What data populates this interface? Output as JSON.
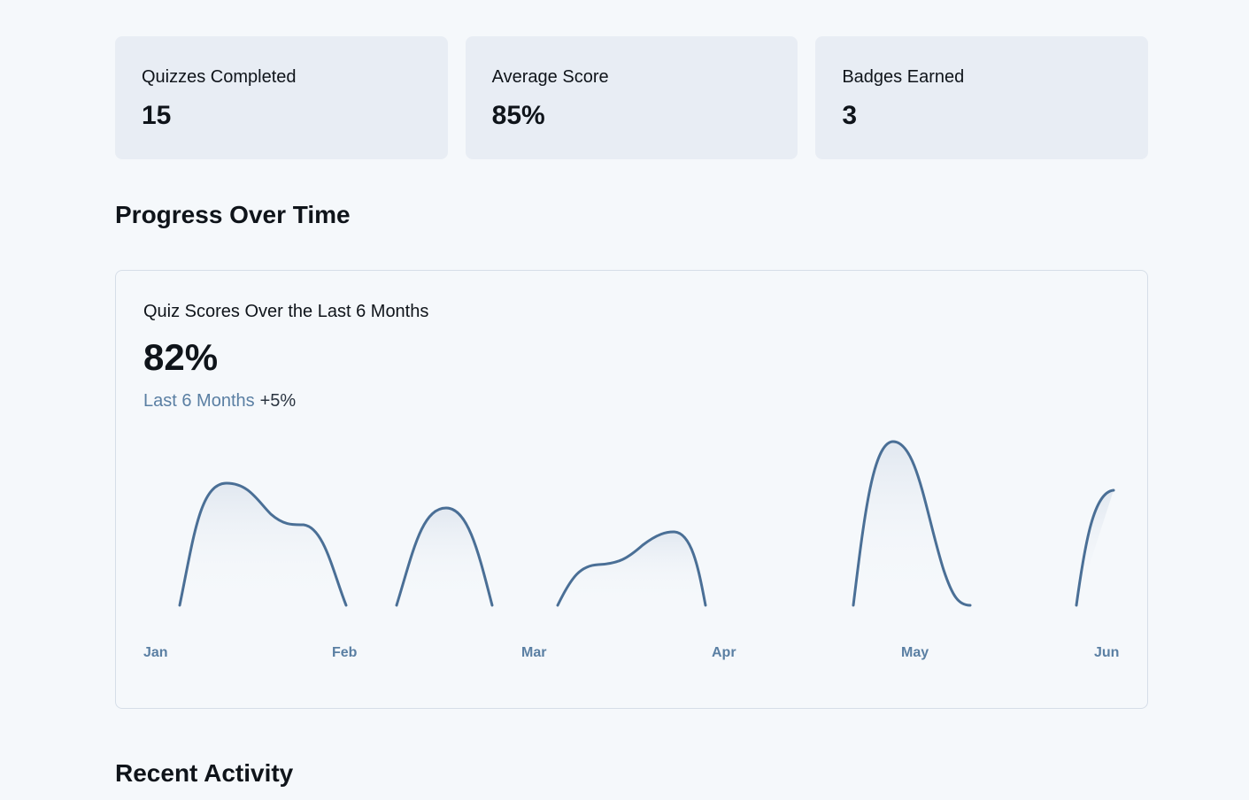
{
  "stats": [
    {
      "label": "Quizzes Completed",
      "value": "15"
    },
    {
      "label": "Average Score",
      "value": "85%"
    },
    {
      "label": "Badges Earned",
      "value": "3"
    }
  ],
  "sections": {
    "progress_title": "Progress Over Time",
    "recent_title": "Recent Activity"
  },
  "chart": {
    "title": "Quiz Scores Over the Last 6 Months",
    "headline_value": "82%",
    "period_label": "Last 6 Months",
    "change": "+5%",
    "line_color": "#4a6f96"
  },
  "chart_data": {
    "type": "line",
    "title": "Quiz Scores Over the Last 6 Months",
    "categories": [
      "Jan",
      "Feb",
      "Mar",
      "Apr",
      "May",
      "Jun"
    ],
    "xlabel": "",
    "ylabel": "",
    "grid": false,
    "legend": "none"
  }
}
